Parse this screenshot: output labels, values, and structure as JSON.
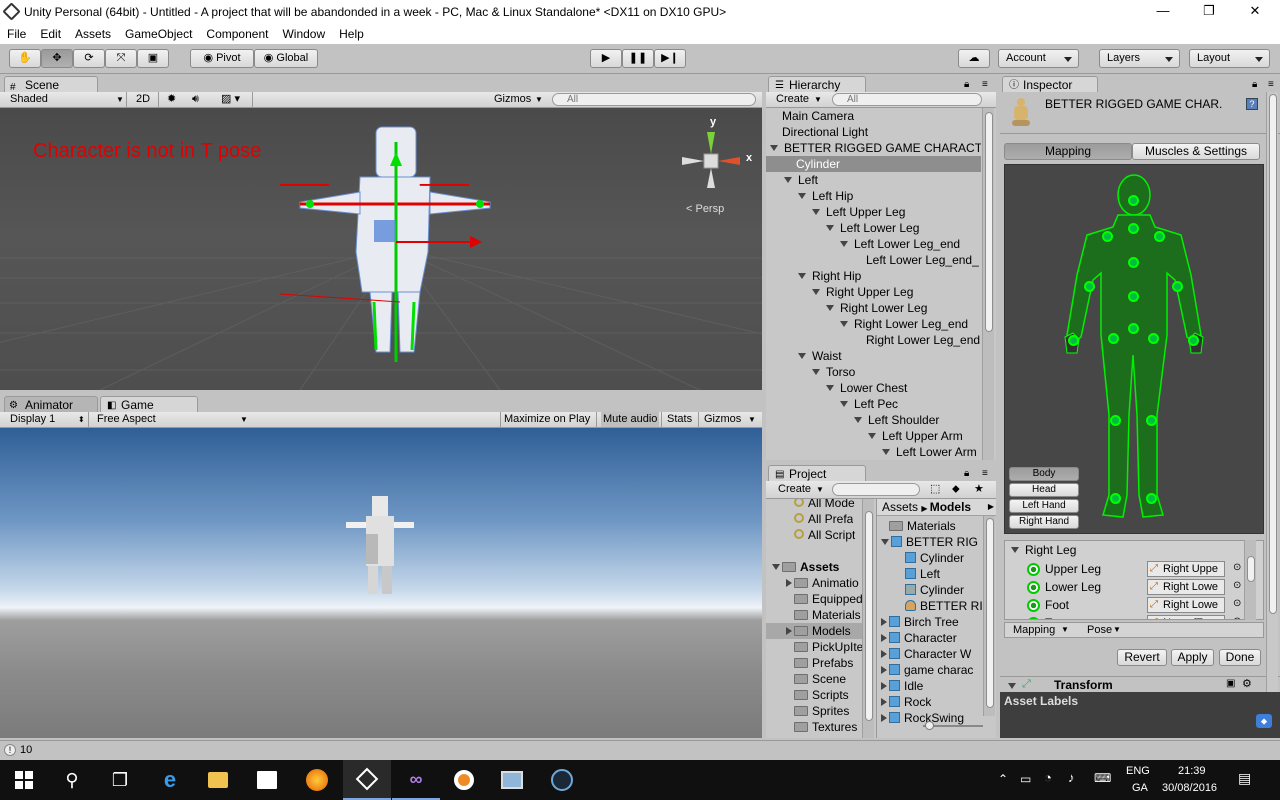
{
  "window": {
    "title": "Unity Personal (64bit) - Untitled - A project that will be abandonded in a week - PC, Mac & Linux Standalone* <DX11 on DX10 GPU>",
    "minimize": "—",
    "maximize": "❐",
    "close": "✕"
  },
  "menu": [
    "File",
    "Edit",
    "Assets",
    "GameObject",
    "Component",
    "Window",
    "Help"
  ],
  "toolbar": {
    "pivot": "Pivot",
    "global": "Global",
    "account": "Account",
    "layers": "Layers",
    "layout": "Layout"
  },
  "scene": {
    "tab": "Scene",
    "shading": "Shaded",
    "mode2d": "2D",
    "gizmos": "Gizmos",
    "search_placeholder": "All",
    "persp": "< Persp",
    "overlay_text": "Character is not in T pose",
    "axis_x": "x",
    "axis_y": "y"
  },
  "game": {
    "tabs": [
      "Animator",
      "Game"
    ],
    "display": "Display 1",
    "aspect": "Free Aspect",
    "maximize": "Maximize on Play",
    "mute": "Mute audio",
    "stats": "Stats",
    "gizmos": "Gizmos"
  },
  "hierarchy": {
    "tab": "Hierarchy",
    "create": "Create",
    "search_placeholder": "All",
    "items": [
      {
        "label": "Main Camera",
        "indent": 0,
        "arrow": ""
      },
      {
        "label": "Directional Light",
        "indent": 0,
        "arrow": ""
      },
      {
        "label": "BETTER RIGGED GAME CHARACTER",
        "indent": 0,
        "arrow": "down"
      },
      {
        "label": "Cylinder",
        "indent": 1,
        "arrow": "",
        "selected": true
      },
      {
        "label": "Left",
        "indent": 1,
        "arrow": "down"
      },
      {
        "label": "Left Hip",
        "indent": 2,
        "arrow": "down"
      },
      {
        "label": "Left Upper Leg",
        "indent": 3,
        "arrow": "down"
      },
      {
        "label": "Left Lower Leg",
        "indent": 4,
        "arrow": "down"
      },
      {
        "label": "Left Lower Leg_end",
        "indent": 5,
        "arrow": "down"
      },
      {
        "label": "Left Lower Leg_end_",
        "indent": 6,
        "arrow": ""
      },
      {
        "label": "Right Hip",
        "indent": 2,
        "arrow": "down"
      },
      {
        "label": "Right Upper Leg",
        "indent": 3,
        "arrow": "down"
      },
      {
        "label": "Right Lower Leg",
        "indent": 4,
        "arrow": "down"
      },
      {
        "label": "Right Lower Leg_end",
        "indent": 5,
        "arrow": "down"
      },
      {
        "label": "Right Lower Leg_end",
        "indent": 6,
        "arrow": ""
      },
      {
        "label": "Waist",
        "indent": 2,
        "arrow": "down"
      },
      {
        "label": "Torso",
        "indent": 3,
        "arrow": "down"
      },
      {
        "label": "Lower Chest",
        "indent": 4,
        "arrow": "down"
      },
      {
        "label": "Left Pec",
        "indent": 5,
        "arrow": "down"
      },
      {
        "label": "Left Shoulder",
        "indent": 6,
        "arrow": "down"
      },
      {
        "label": "Left Upper Arm",
        "indent": 7,
        "arrow": "down"
      },
      {
        "label": "Left Lower Arm",
        "indent": 8,
        "arrow": "down"
      }
    ]
  },
  "project": {
    "tab": "Project",
    "create": "Create",
    "favorites": [
      "All Mode",
      "All Prefa",
      "All Script"
    ],
    "tree": [
      {
        "label": "Assets",
        "bold": true,
        "arrow": "down"
      },
      {
        "label": "Animatio",
        "arrow": "right"
      },
      {
        "label": "Equipped",
        "arrow": ""
      },
      {
        "label": "Materials",
        "arrow": ""
      },
      {
        "label": "Models",
        "arrow": "right",
        "selected": true
      },
      {
        "label": "PickUpIte",
        "arrow": ""
      },
      {
        "label": "Prefabs",
        "arrow": ""
      },
      {
        "label": "Scene",
        "arrow": ""
      },
      {
        "label": "Scripts",
        "arrow": ""
      },
      {
        "label": "Sprites",
        "arrow": ""
      },
      {
        "label": "Textures",
        "arrow": ""
      }
    ],
    "breadcrumb_root": "Assets",
    "breadcrumb_current": "Models",
    "files": [
      {
        "label": "Materials",
        "kind": "folder",
        "indent": 0,
        "arrow": ""
      },
      {
        "label": "BETTER RIG",
        "kind": "model",
        "indent": 0,
        "arrow": "down"
      },
      {
        "label": "Cylinder",
        "kind": "model",
        "indent": 1,
        "arrow": ""
      },
      {
        "label": "Left",
        "kind": "model",
        "indent": 1,
        "arrow": ""
      },
      {
        "label": "Cylinder",
        "kind": "mesh",
        "indent": 1,
        "arrow": ""
      },
      {
        "label": "BETTER RI",
        "kind": "avatar",
        "indent": 1,
        "arrow": ""
      },
      {
        "label": "Birch Tree",
        "kind": "model",
        "indent": 0,
        "arrow": "right"
      },
      {
        "label": "Character",
        "kind": "model",
        "indent": 0,
        "arrow": "right"
      },
      {
        "label": "Character W",
        "kind": "model",
        "indent": 0,
        "arrow": "right"
      },
      {
        "label": "game charac",
        "kind": "model",
        "indent": 0,
        "arrow": "right"
      },
      {
        "label": "Idle",
        "kind": "model",
        "indent": 0,
        "arrow": "right"
      },
      {
        "label": "Rock",
        "kind": "model",
        "indent": 0,
        "arrow": "right"
      },
      {
        "label": "RockSwing",
        "kind": "model",
        "indent": 0,
        "arrow": "right"
      }
    ]
  },
  "inspector": {
    "tab": "Inspector",
    "object_name": "BETTER RIGGED GAME CHAR.",
    "tabs": [
      "Mapping",
      "Muscles & Settings"
    ],
    "body_buttons": [
      "Body",
      "Head",
      "Left Hand",
      "Right Hand"
    ],
    "group_title": "Right Leg",
    "bones": [
      {
        "label": "Upper Leg",
        "target": "Right Uppe"
      },
      {
        "label": "Lower Leg",
        "target": "Right Lowe"
      },
      {
        "label": "Foot",
        "target": "Right Lowe"
      },
      {
        "label": "Toes",
        "target": "None (Tra"
      }
    ],
    "mapping_dd": "Mapping",
    "pose_dd": "Pose",
    "revert": "Revert",
    "apply": "Apply",
    "done": "Done",
    "transform": "Transform",
    "asset_labels": "Asset Labels"
  },
  "status": {
    "count": "10"
  },
  "taskbar": {
    "lang1": "ENG",
    "lang2": "GA",
    "time": "21:39",
    "date": "30/08/2016"
  },
  "colors": {
    "accent_green": "#00e000",
    "overlay_red": "#e00000",
    "selection": "#8e8e8e"
  }
}
